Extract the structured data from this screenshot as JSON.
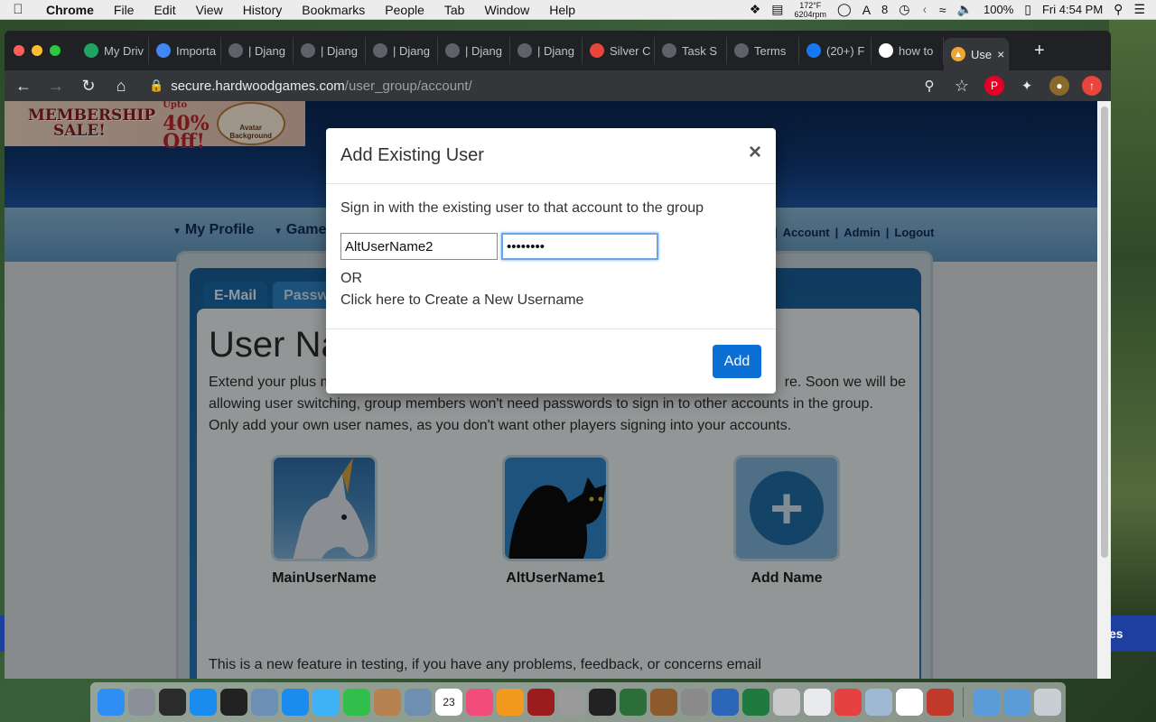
{
  "menubar": {
    "apple_icon": "apple-icon",
    "app": "Chrome",
    "items": [
      "File",
      "Edit",
      "View",
      "History",
      "Bookmarks",
      "People",
      "Tab",
      "Window",
      "Help"
    ],
    "temp": "172°F",
    "fan": "6204rpm",
    "adobe_count": "8",
    "battery": "100%",
    "clock": "Fri 4:54 PM"
  },
  "browser": {
    "tabs": [
      {
        "label": "My Driv",
        "favicon_color": "#1fa463"
      },
      {
        "label": "Importa",
        "favicon_color": "#4285f4"
      },
      {
        "label": "| Djang",
        "favicon_color": "#5f6368"
      },
      {
        "label": "| Djang",
        "favicon_color": "#5f6368"
      },
      {
        "label": "| Djang",
        "favicon_color": "#5f6368"
      },
      {
        "label": "| Djang",
        "favicon_color": "#5f6368"
      },
      {
        "label": "| Djang",
        "favicon_color": "#5f6368"
      },
      {
        "label": "Silver C",
        "favicon_color": "#e8453c"
      },
      {
        "label": "Task S",
        "favicon_color": "#5f6368"
      },
      {
        "label": "Terms",
        "favicon_color": "#5f6368"
      },
      {
        "label": "(20+) F",
        "favicon_color": "#1877f2"
      },
      {
        "label": "how to",
        "favicon_color": "#ffffff"
      }
    ],
    "active_tab": {
      "label": "Use",
      "favicon_color": "#f2a531"
    },
    "url_host": "secure.hardwoodgames.com",
    "url_path": "/user_group/account/"
  },
  "page": {
    "promo": {
      "line1": "MEMBERSHIP",
      "line2": "SALE!",
      "upto": "Upto",
      "pct": "40%",
      "off": "Off!",
      "badge": "Avatar Background"
    },
    "nav": {
      "my_profile": "My Profile",
      "games": "Game",
      "links": [
        "Account",
        "Admin",
        "Logout"
      ]
    },
    "tabs": [
      "E-Mail",
      "Passwo"
    ],
    "title": "User Na",
    "description_line1": "Extend your plus m",
    "description_line1_end": "re. Soon we will be",
    "description_line2": "allowing user switching, group members won't need passwords to sign in to other accounts in the group.",
    "description_line3": "Only add your own user names, as you don't want other players signing into your accounts.",
    "users": [
      {
        "name": "MainUserName",
        "avatar": "unicorn"
      },
      {
        "name": "AltUserName1",
        "avatar": "black-cat"
      },
      {
        "name": "Add Name",
        "avatar": "add"
      }
    ],
    "footer": "This is a new feature in testing, if you have any problems, feedback, or concerns email"
  },
  "modal": {
    "title": "Add Existing User",
    "close": "×",
    "instruction": "Sign in with the existing user to that account to the group",
    "username_value": "AltUserName2",
    "password_value": "••••••••",
    "or": "OR",
    "create_link": "Click here to Create a New Username",
    "add_button": "Add"
  },
  "dock": {
    "apps": [
      {
        "name": "finder",
        "color": "#2f8ef4"
      },
      {
        "name": "launchpad",
        "color": "#8a8f98"
      },
      {
        "name": "mission-control",
        "color": "#2b2b2b"
      },
      {
        "name": "app-store",
        "color": "#1a8cf0",
        "badge": "2"
      },
      {
        "name": "activity-monitor",
        "color": "#222"
      },
      {
        "name": "preview",
        "color": "#6b8fb5"
      },
      {
        "name": "safari",
        "color": "#1a8cf0"
      },
      {
        "name": "messages",
        "color": "#3fb2f5"
      },
      {
        "name": "facetime",
        "color": "#2fbf4a"
      },
      {
        "name": "contacts",
        "color": "#b68250"
      },
      {
        "name": "mail",
        "color": "#6f8fb0"
      },
      {
        "name": "calendar",
        "color": "#ffffff",
        "text": "23"
      },
      {
        "name": "itunes",
        "color": "#f14c7a"
      },
      {
        "name": "ibooks",
        "color": "#f39a1e"
      },
      {
        "name": "photo-booth",
        "color": "#9b1c1c"
      },
      {
        "name": "no-entry",
        "color": "#9a9a9a"
      },
      {
        "name": "imovie",
        "color": "#222"
      },
      {
        "name": "time-machine",
        "color": "#2b6e3a"
      },
      {
        "name": "garageband",
        "color": "#8d5a2b"
      },
      {
        "name": "system-preferences",
        "color": "#8a8a8a"
      },
      {
        "name": "word",
        "color": "#2b66b8"
      },
      {
        "name": "excel",
        "color": "#1f7a3f"
      },
      {
        "name": "script-editor",
        "color": "#c9c9c9"
      },
      {
        "name": "chrome",
        "color": "#e8eaed"
      },
      {
        "name": "popcorn",
        "color": "#e64141"
      },
      {
        "name": "image-capture",
        "color": "#9fb9d3"
      },
      {
        "name": "photos",
        "color": "#ffffff"
      },
      {
        "name": "game",
        "color": "#c0392b"
      }
    ],
    "folders": [
      {
        "name": "applications-folder",
        "color": "#5a9bd8"
      },
      {
        "name": "documents-folder",
        "color": "#5a9bd8"
      },
      {
        "name": "trash",
        "color": "#c9ced4"
      }
    ]
  }
}
